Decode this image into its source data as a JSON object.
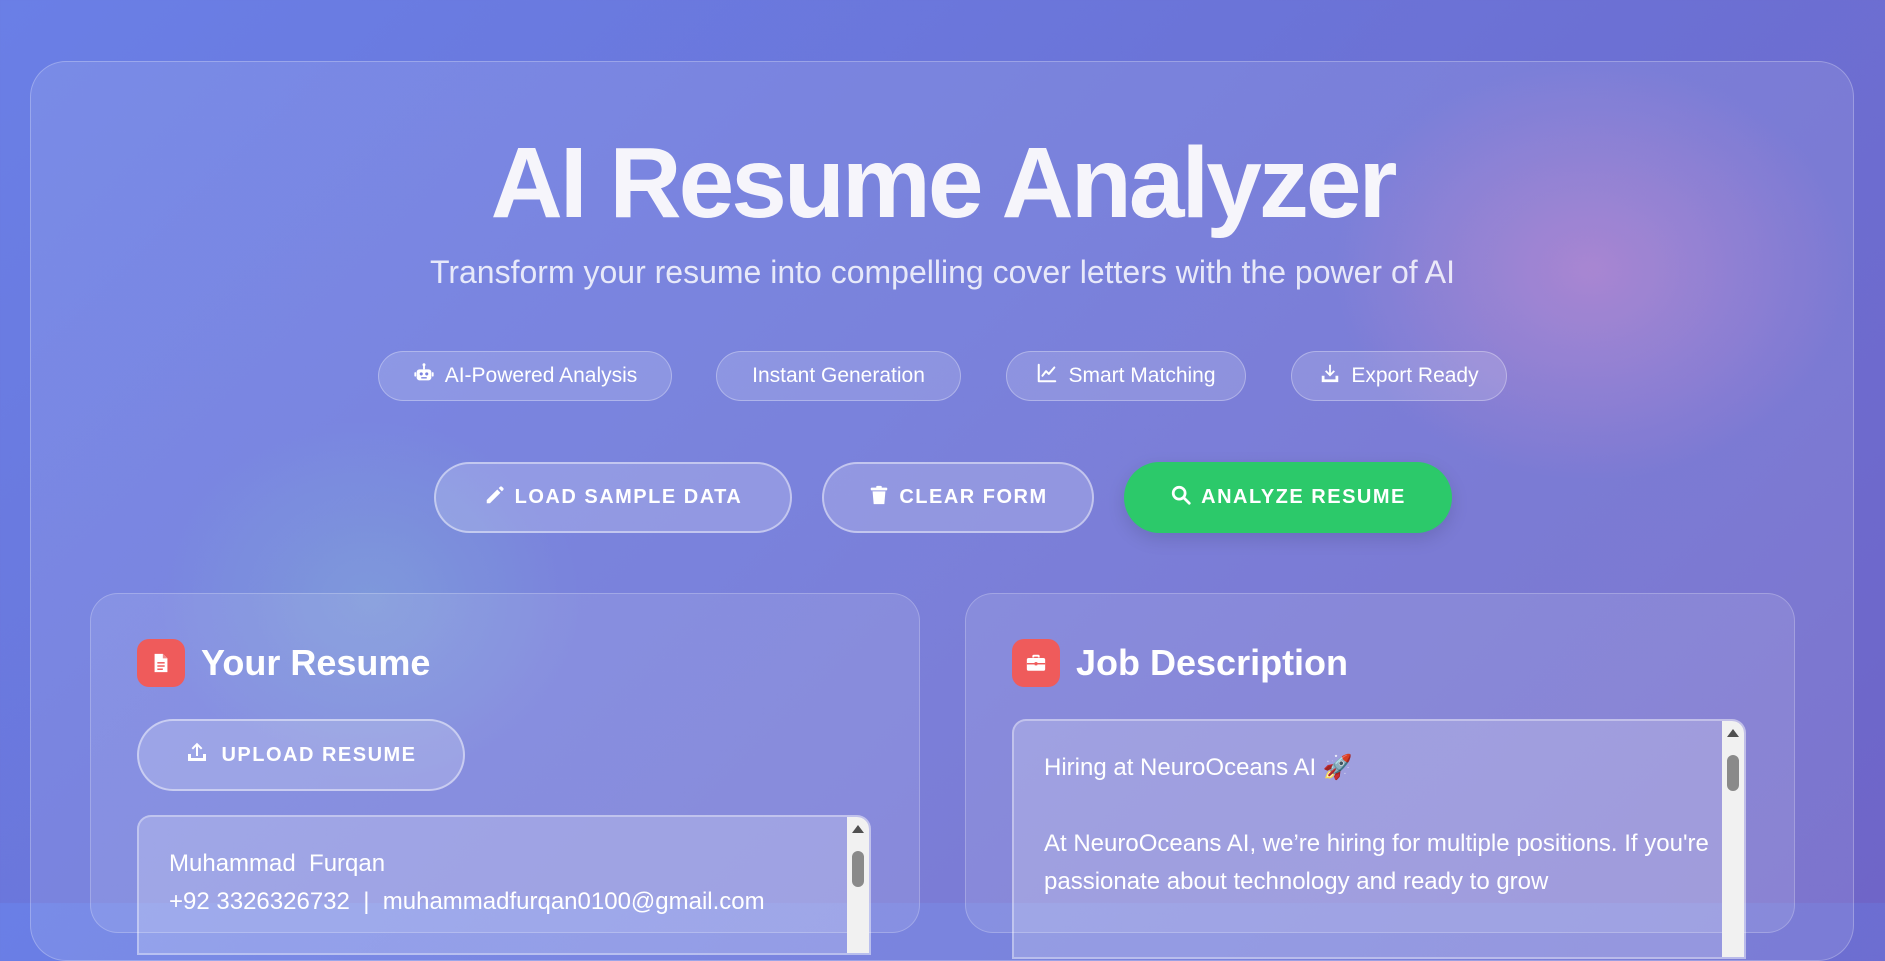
{
  "header": {
    "title": "AI Resume Analyzer",
    "subtitle": "Transform your resume into compelling cover letters with the power of AI"
  },
  "features": [
    {
      "label": "AI-Powered Analysis",
      "icon": "robot-icon"
    },
    {
      "label": "Instant Generation",
      "icon": ""
    },
    {
      "label": "Smart Matching",
      "icon": "chart-line-icon"
    },
    {
      "label": "Export Ready",
      "icon": "download-icon"
    }
  ],
  "actions": {
    "load_sample": "LOAD SAMPLE DATA",
    "clear_form": "CLEAR FORM",
    "analyze": "ANALYZE RESUME"
  },
  "resume_panel": {
    "title": "Your Resume",
    "upload_label": "UPLOAD RESUME",
    "text": "Muhammad  Furqan\n+92 3326326732  |  muhammadfurqan0100@gmail.com"
  },
  "job_panel": {
    "title": "Job Description",
    "text": "Hiring at NeuroOceans AI 🚀\n\nAt NeuroOceans AI, we’re hiring for multiple positions. If you're passionate about technology and ready to grow"
  },
  "colors": {
    "accent_green": "#2cc96a",
    "icon_red": "#ef5b5b"
  }
}
